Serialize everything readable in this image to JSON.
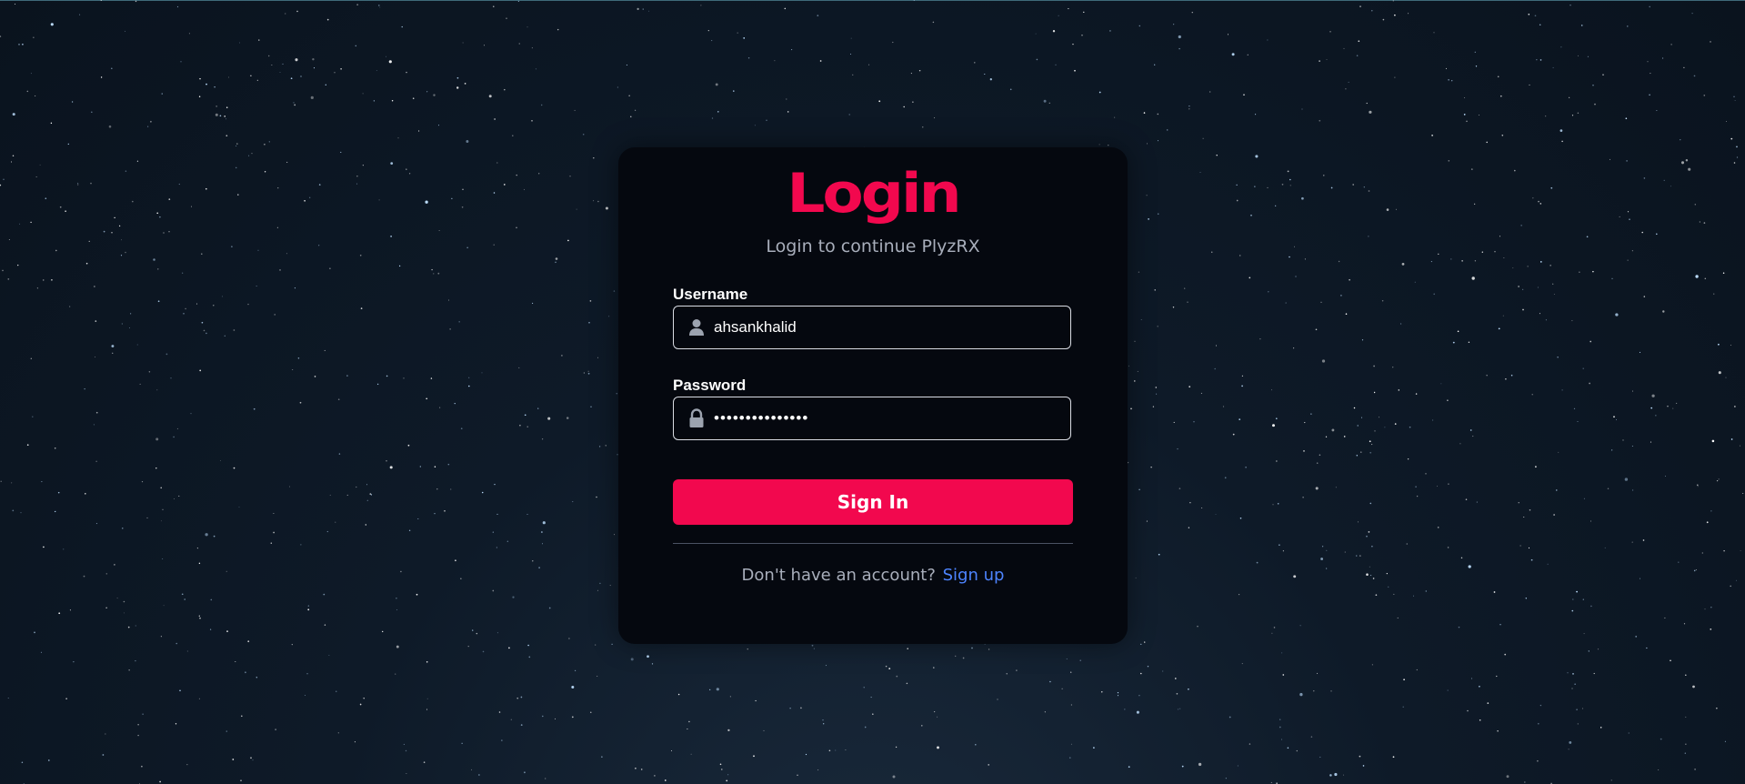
{
  "login": {
    "title": "Login",
    "subtitle": "Login to continue PlyzRX",
    "username_label": "Username",
    "username_value": "ahsankhalid",
    "username_icon": "user-icon",
    "password_label": "Password",
    "password_value": "•••••••••••••••",
    "password_icon": "lock-icon",
    "signin_label": "Sign In",
    "no_account_text": "Don't have an account?",
    "signup_link": "Sign up"
  },
  "colors": {
    "accent": "#f2084e",
    "link": "#4d84ff",
    "card_bg": "#05080f",
    "page_bg": "#0e1a28"
  }
}
